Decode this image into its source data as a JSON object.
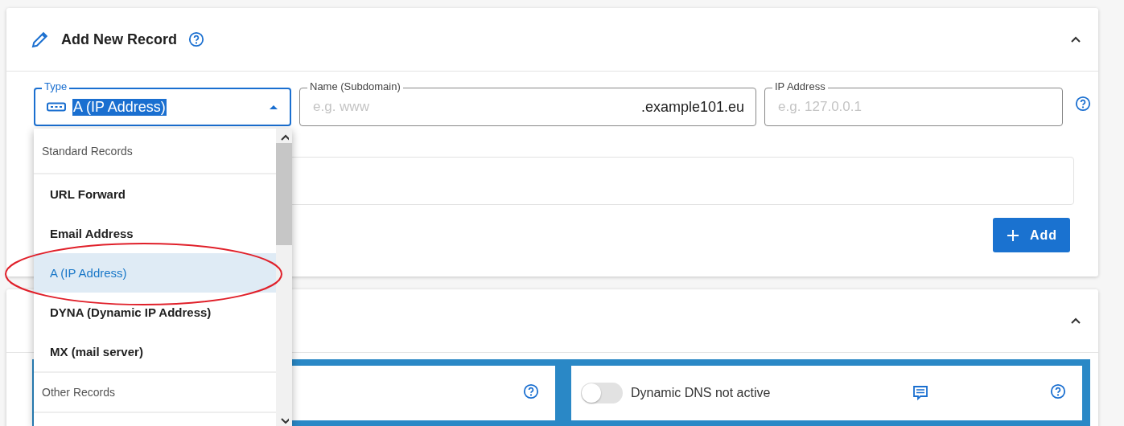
{
  "record_card": {
    "title": "Add New Record",
    "expanded": true
  },
  "fields": [
    {
      "kind": "select",
      "label": "Type",
      "value": "A (IP Address)",
      "focused": true
    },
    {
      "kind": "text",
      "label": "Name (Subdomain)",
      "placeholder": "e.g. www",
      "suffix": ".example101.eu",
      "focused": false
    },
    {
      "kind": "text",
      "label": "IP Address",
      "placeholder": "e.g. 127.0.0.1",
      "focused": false
    }
  ],
  "add_button": {
    "label": "Add"
  },
  "dropdown": {
    "groups": [
      {
        "title": "Standard Records",
        "items": [
          {
            "label": "URL Forward",
            "selected": false
          },
          {
            "label": "Email Address",
            "selected": false
          },
          {
            "label": "A (IP Address)",
            "selected": true
          },
          {
            "label": "DYNA (Dynamic IP Address)",
            "selected": false
          },
          {
            "label": "MX (mail server)",
            "selected": false
          }
        ]
      },
      {
        "title": "Other Records"
      }
    ]
  },
  "second_card": {
    "expanded": true,
    "dynamic_dns": {
      "label": "Dynamic DNS not active",
      "on": false
    }
  }
}
